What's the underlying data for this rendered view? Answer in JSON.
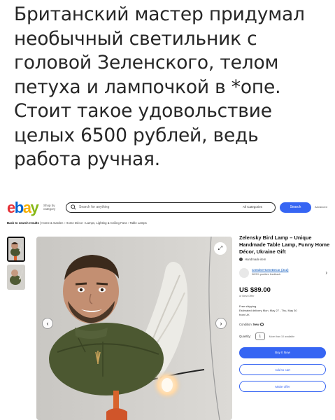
{
  "caption": {
    "lines": [
      "Британский мастер придумал",
      "необычный светильник с",
      "головой Зеленского, телом",
      "петуха и лампочкой в *опе.",
      "Стоит такое удовольствие",
      "целых 6500 рублей, ведь",
      "работа ручная."
    ]
  },
  "ebay": {
    "logo": {
      "e": "e",
      "b": "b",
      "a": "a",
      "y": "y"
    },
    "shop_by_category": "Shop by category",
    "search_placeholder": "Search for anything",
    "search_category": "All Categories",
    "search_button": "Search",
    "advanced": "Advanced",
    "breadcrumb": {
      "back": "Back to search results",
      "items": [
        "Home & Garden",
        "Home Décor",
        "Lamps, Lighting & Ceiling Fans",
        "Table Lamps"
      ]
    },
    "listing": {
      "title": "Zelensky Bird Lamp – Unique Handmade Table Lamp, Funny Home Décor, Ukraine Gift",
      "handmade": "Handmade item",
      "seller_name": "CreativeHomeDecor (342)",
      "seller_feedback": "98.5% positive feedback",
      "price": "US $89.00",
      "best_offer": "or Best Offer",
      "shipping": "Free shipping",
      "delivery": "Estimated delivery Mon, May 27 - Thu, May 30",
      "from": "from UK",
      "condition_label": "Condition:",
      "condition_value": "New",
      "quantity_label": "Quantity:",
      "quantity_value": "1",
      "quantity_avail": "More than 10 available",
      "buy_now": "Buy It Now",
      "add_to_cart": "Add to cart",
      "make_offer": "Make offer"
    },
    "colors": {
      "accent": "#3665f3",
      "link": "#0654ba"
    }
  }
}
